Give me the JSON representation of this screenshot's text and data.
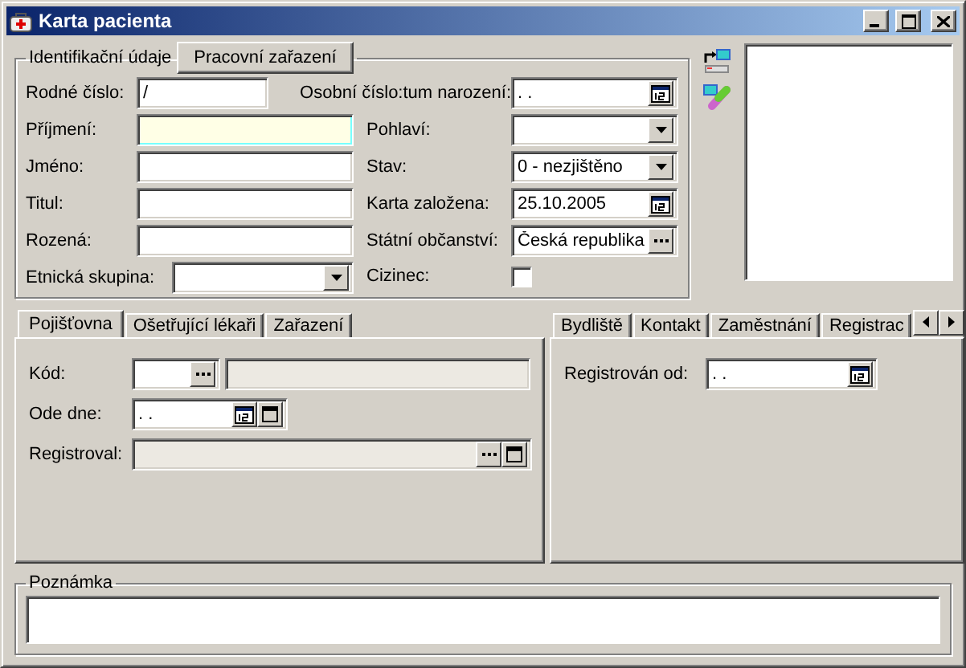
{
  "window": {
    "title": "Karta pacienta"
  },
  "identification": {
    "legend": "Identifikační údaje",
    "tab_button": "Pracovní zařazení",
    "left_fields": [
      {
        "label": "Rodné číslo:",
        "kind": "short_text",
        "value": "/",
        "focused": false
      },
      {
        "label": "Příjmení:",
        "kind": "text",
        "focused": true
      },
      {
        "label": "Jméno:",
        "kind": "text",
        "focused": false
      },
      {
        "label": "Titul:",
        "kind": "text",
        "focused": false
      },
      {
        "label": "Rozená:",
        "kind": "text",
        "focused": false
      },
      {
        "label": "Etnická skupina:",
        "kind": "combo",
        "focused": false
      }
    ],
    "right_fields": [
      {
        "label": "Osobní číslo:tum narození:",
        "kind": "date",
        "value": ". ."
      },
      {
        "label": "Pohlaví:",
        "kind": "combo"
      },
      {
        "label": "Stav:",
        "kind": "combo",
        "value": "0 - nezjištěno"
      },
      {
        "label": "Karta založena:",
        "kind": "date",
        "value": "25.10.2005"
      },
      {
        "label": "Státní občanství:",
        "kind": "lookup",
        "value": "Česká republika"
      },
      {
        "label": "Cizinec:",
        "kind": "checkbox",
        "checked": false
      }
    ]
  },
  "left_tabs": {
    "tabs": [
      {
        "label": "Pojišťovna",
        "selected": true
      },
      {
        "label": "Ošetřující lékaři",
        "selected": false
      },
      {
        "label": "Zařazení",
        "selected": false
      }
    ],
    "rows": [
      {
        "label": "Kód:",
        "kind": "code",
        "disabled": true
      },
      {
        "label": "Ode dne:",
        "kind": "date_with_button",
        "value": ". .",
        "disabled": false
      },
      {
        "label": "Registroval:",
        "kind": "lookup_with_button",
        "disabled": true
      }
    ]
  },
  "right_tabs": {
    "tabs": [
      {
        "label": "Bydliště",
        "selected": false
      },
      {
        "label": "Kontakt",
        "selected": false
      },
      {
        "label": "Zaměstnání",
        "selected": false
      },
      {
        "label": "Registrac",
        "selected": false
      }
    ],
    "rows": [
      {
        "label": "Registrován od:",
        "kind": "date",
        "value": ". .",
        "disabled": false
      }
    ]
  },
  "note": {
    "legend": "Poznámka"
  }
}
